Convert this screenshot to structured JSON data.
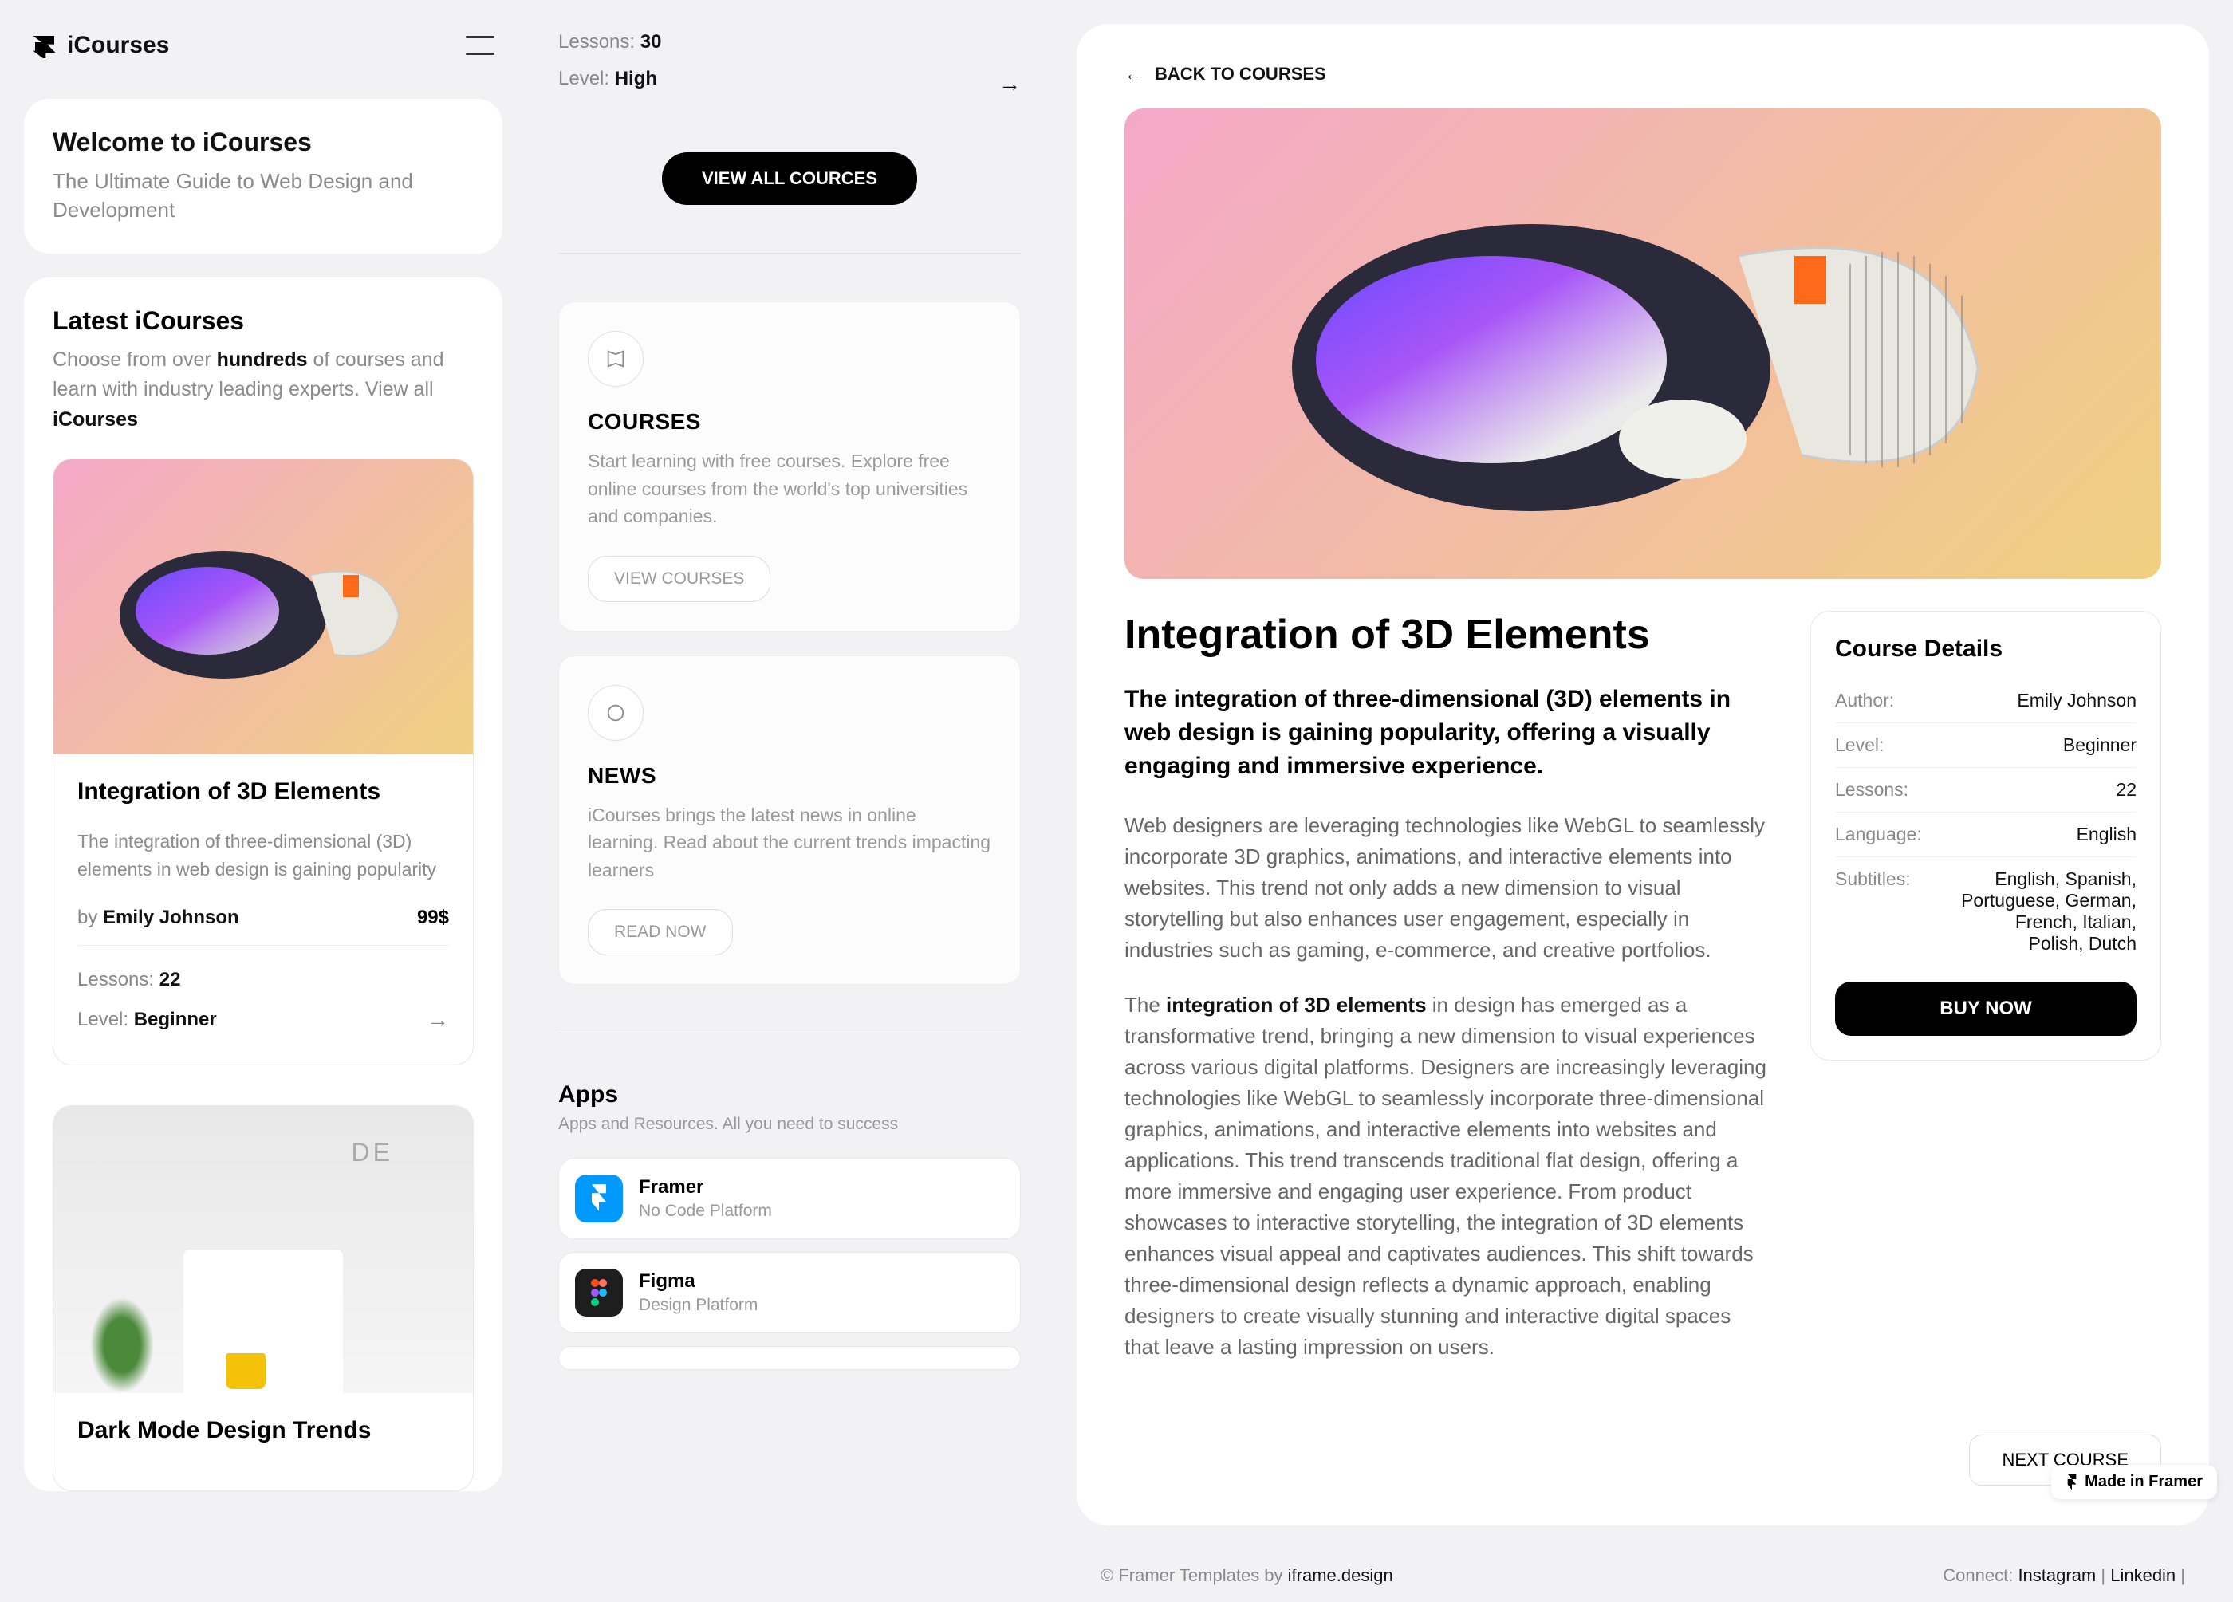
{
  "brand": "iCourses",
  "welcome": {
    "title": "Welcome to iCourses",
    "subtitle": "The Ultimate Guide to Web Design and Development"
  },
  "latest": {
    "title": "Latest iCourses",
    "prefix": "Choose from over ",
    "bold1": "hundreds",
    "mid": " of courses and learn with industry leading experts. View all ",
    "bold2": "iCourses"
  },
  "course1": {
    "title": "Integration of 3D Elements",
    "desc": "The integration of three-dimensional (3D) elements in web design is gaining popularity",
    "by": "by ",
    "author": "Emily Johnson",
    "price": "99$",
    "lessonsLabel": "Lessons: ",
    "lessons": "22",
    "levelLabel": "Level: ",
    "level": "Beginner"
  },
  "course2": {
    "title": "Dark Mode Design Trends"
  },
  "mid": {
    "lessonsLabel": "Lessons: ",
    "lessons": "30",
    "levelLabel": "Level: ",
    "level": "High",
    "viewAll": "VIEW ALL COURCES",
    "promo1": {
      "title": "COURSES",
      "desc": "Start learning with free courses. Explore free online courses from the world's top universities and companies.",
      "btn": "VIEW COURSES"
    },
    "promo2": {
      "title": "NEWS",
      "desc": "iCourses brings the latest news in online learning. Read about the current trends impacting learners",
      "btn": "READ NOW"
    },
    "apps": {
      "title": "Apps",
      "sub": "Apps and Resources. All you need to success",
      "list": [
        {
          "name": "Framer",
          "tag": "No Code Platform"
        },
        {
          "name": "Figma",
          "tag": "Design Platform"
        }
      ]
    }
  },
  "detail": {
    "back": "BACK TO COURSES",
    "title": "Integration of 3D Elements",
    "lead": "The integration of three-dimensional (3D) elements in web design is gaining popularity, offering a visually engaging and immersive experience.",
    "para1": "Web designers are leveraging technologies like WebGL to seamlessly incorporate 3D graphics, animations, and interactive elements into websites. This trend not only adds a new dimension to visual storytelling but also enhances user engagement, especially in industries such as gaming, e-commerce, and creative portfolios.",
    "para2a": "The ",
    "para2bold": "integration of 3D elements",
    "para2b": " in design has emerged as a transformative trend, bringing a new dimension to visual experiences across various digital platforms. Designers are increasingly leveraging technologies like WebGL to seamlessly incorporate three-dimensional graphics, animations, and interactive elements into websites and applications. This trend transcends traditional flat design, offering a more immersive and engaging user experience. From product showcases to interactive storytelling, the integration of 3D elements enhances visual appeal and captivates audiences. This shift towards three-dimensional design reflects a dynamic approach, enabling designers to create visually stunning and interactive digital spaces that leave a lasting impression on users.",
    "side": {
      "title": "Course Details",
      "author": {
        "label": "Author:",
        "val": "Emily Johnson"
      },
      "level": {
        "label": "Level:",
        "val": "Beginner"
      },
      "lessons": {
        "label": "Lessons:",
        "val": "22"
      },
      "language": {
        "label": "Language:",
        "val": "English"
      },
      "subtitles": {
        "label": "Subtitles:",
        "val": "English, Spanish, Portuguese, German, French, Italian, Polish, Dutch"
      },
      "buy": "BUY NOW"
    },
    "next": "NEXT COURSE"
  },
  "footer": {
    "leftPrefix": "© Framer Templates by ",
    "leftLink": "iframe.design",
    "rightPrefix": "Connect: ",
    "link1": "Instagram",
    "link2": "Linkedin"
  },
  "badge": "Made in Framer"
}
